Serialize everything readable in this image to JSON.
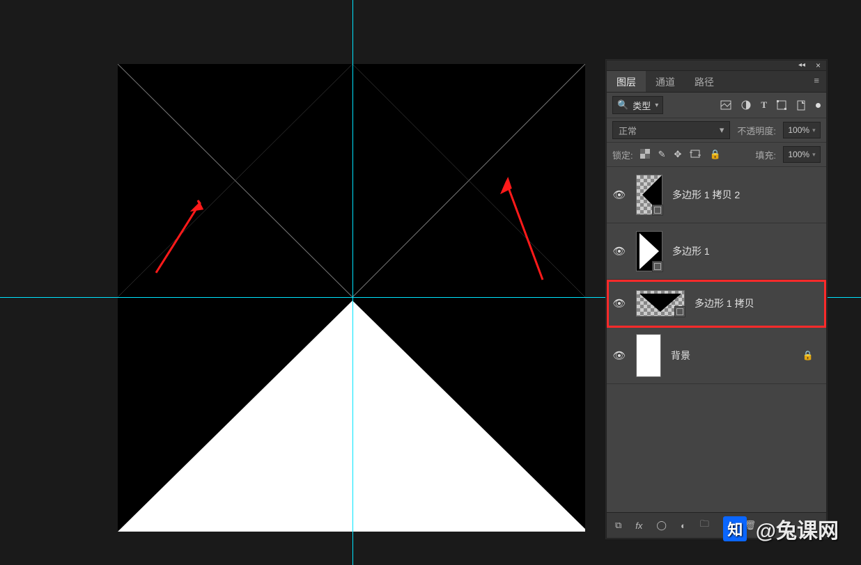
{
  "tabs": {
    "layers": "图层",
    "channels": "通道",
    "paths": "路径"
  },
  "filter": {
    "type_label": "类型"
  },
  "blend": {
    "mode": "正常",
    "opacity_label": "不透明度:",
    "opacity_value": "100%"
  },
  "lock": {
    "label": "锁定:",
    "fill_label": "填充:",
    "fill_value": "100%"
  },
  "layers": [
    {
      "name": "多边形 1 拷贝 2"
    },
    {
      "name": "多边形 1"
    },
    {
      "name": "多边形 1 拷贝"
    },
    {
      "name": "背景"
    }
  ],
  "watermark": {
    "zhi": "知",
    "text": " @兔课网"
  }
}
